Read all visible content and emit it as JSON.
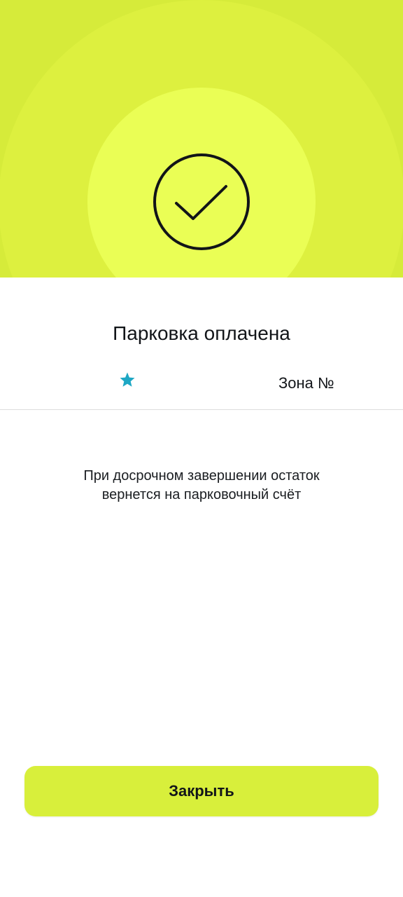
{
  "header": {
    "status_icon": "check-circle-icon",
    "colors": {
      "background": "#d6eb3a",
      "outer_ring": "#ddf03f",
      "inner_ring": "#eafe55"
    }
  },
  "main": {
    "title": "Парковка оплачена",
    "info": {
      "favorite_icon": "star-icon",
      "star_color": "#1ea7c4",
      "zone_label": "Зона №"
    },
    "notice_lines": [
      "При досрочном завершении остаток",
      "вернется на парковочный счёт"
    ]
  },
  "footer": {
    "close_label": "Закрыть",
    "accent": "#d8ef3b"
  }
}
